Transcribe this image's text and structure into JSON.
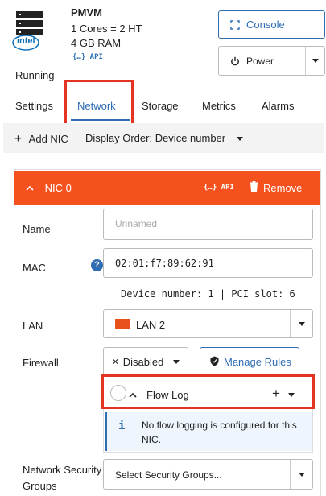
{
  "vm": {
    "name": "PMVM",
    "cores": "1 Cores = 2 HT",
    "ram": "4 GB RAM",
    "api_label": "{…} API",
    "status": "Running",
    "logo_text": "intel"
  },
  "actions": {
    "console_label": "Console",
    "power_label": "Power"
  },
  "tabs": [
    {
      "label": "Settings"
    },
    {
      "label": "Network"
    },
    {
      "label": "Storage"
    },
    {
      "label": "Metrics"
    },
    {
      "label": "Alarms"
    }
  ],
  "toolbar": {
    "add_nic_label": "Add NIC",
    "display_order": "Display Order: Device number"
  },
  "nic": {
    "title": "NIC 0",
    "api_label": "{…} API",
    "remove_label": "Remove",
    "name_label": "Name",
    "name_placeholder": "Unnamed",
    "mac_label": "MAC",
    "mac_value": "02:01:f7:89:62:91",
    "device_info": "Device number: 1 | PCI slot: 6",
    "lan_label": "LAN",
    "lan_value": "LAN 2",
    "lan_color": "#e8501c",
    "firewall_label": "Firewall",
    "firewall_value": "Disabled",
    "manage_rules_label": "Manage Rules",
    "flow_log_label": "Flow Log",
    "flow_info_line1": "No flow logging is configured for this",
    "flow_info_line2": "NIC.",
    "nsg_label_line1": "Network Security",
    "nsg_label_line2": "Groups",
    "nsg_placeholder": "Select Security Groups..."
  },
  "colors": {
    "accent": "#2f6db3",
    "nic_header": "#f4511e",
    "highlight": "#e53323"
  }
}
